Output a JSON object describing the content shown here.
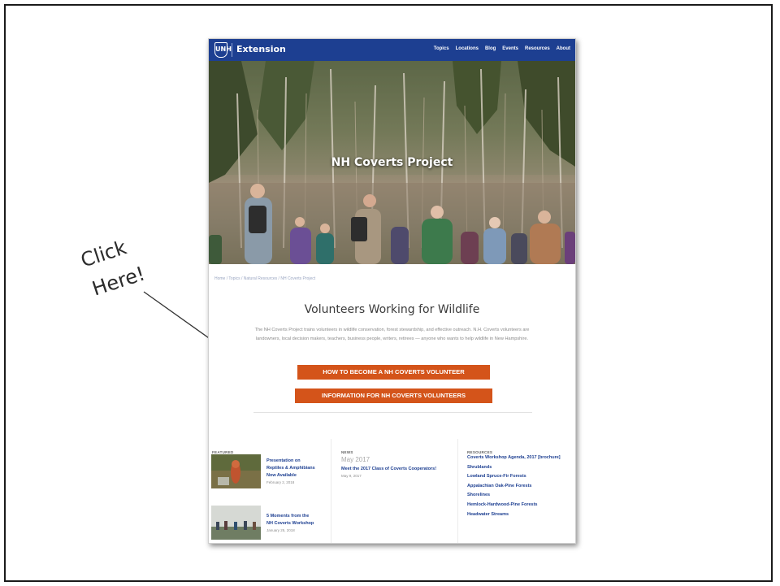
{
  "annotation": {
    "line1": "Click",
    "line2": "Here!"
  },
  "nav": {
    "logo_mark": "UNH",
    "brand": "Extension",
    "links": [
      "Topics",
      "Locations",
      "Blog",
      "Events",
      "Resources",
      "About"
    ]
  },
  "hero": {
    "title": "NH Coverts Project"
  },
  "breadcrumb": "Home / Topics / Natural Resources / NH Coverts Project",
  "section": {
    "title": "Volunteers Working for Wildlife",
    "intro": "The NH Coverts Project trains volunteers in wildlife conservation, forest stewardship, and effective outreach. N.H. Coverts volunteers are landowners, local decision makers, teachers, business people, writers, retirees — anyone who wants to help wildlife in New Hampshire."
  },
  "buttons": {
    "become": "HOW TO BECOME A NH COVERTS VOLUNTEER",
    "info": "INFORMATION FOR NH COVERTS VOLUNTEERS"
  },
  "featured": {
    "heading": "FEATURED",
    "items": [
      {
        "title_l1": "Presentation on",
        "title_l2": "Reptiles & Amphibians",
        "title_l3": "Now Available",
        "date": "February 2, 2018"
      },
      {
        "title_l1": "5 Moments from the",
        "title_l2": "NH Coverts Workshop",
        "title_l3": "",
        "date": "January 25, 2018"
      }
    ]
  },
  "news": {
    "heading": "NEWS",
    "year": "May 2017",
    "title": "Meet the 2017 Class of Coverts Cooperators!",
    "date": "May 9, 2017"
  },
  "resources": {
    "heading": "RESOURCES",
    "items": [
      "Coverts Workshop Agenda, 2017 [brochure]",
      "Shrublands",
      "Lowland Spruce-Fir Forests",
      "Appalachian Oak-Pine Forests",
      "Shorelines",
      "Hemlock-Hardwood-Pine Forests",
      "Headwater Streams"
    ]
  },
  "colors": {
    "nav": "#1d3f91",
    "cta": "#d4541a",
    "link": "#1d3f91"
  }
}
